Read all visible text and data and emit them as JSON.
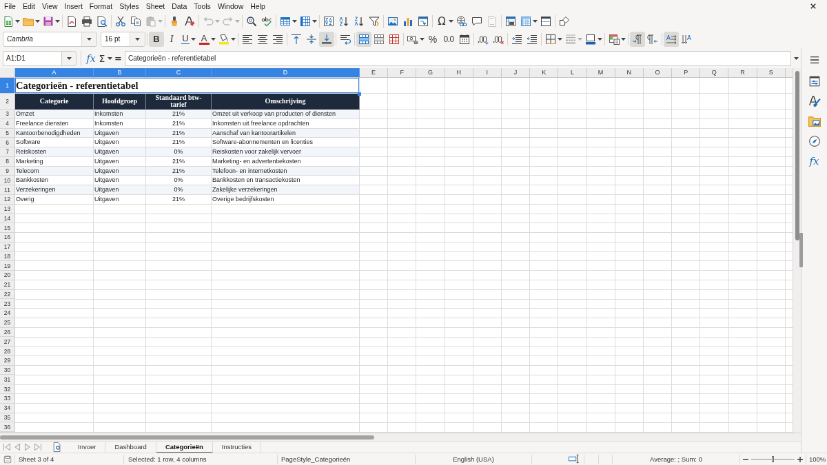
{
  "menu_bar": [
    "File",
    "Edit",
    "View",
    "Insert",
    "Format",
    "Styles",
    "Sheet",
    "Data",
    "Tools",
    "Window",
    "Help"
  ],
  "standard_toolbar": [
    {
      "kind": "new",
      "disabled": false
    },
    {
      "kind": "open",
      "disabled": false
    },
    {
      "kind": "save",
      "disabled": false
    },
    {
      "kind": "pdf",
      "disabled": false
    },
    {
      "kind": "print",
      "disabled": false
    },
    {
      "kind": "preview",
      "disabled": false
    },
    {
      "kind": "cut",
      "disabled": false
    },
    {
      "kind": "copy",
      "disabled": false
    },
    {
      "kind": "paste",
      "disabled": true
    },
    {
      "kind": "clone",
      "disabled": false
    },
    {
      "kind": "clear",
      "disabled": false
    },
    {
      "kind": "undo",
      "disabled": true
    },
    {
      "kind": "redo",
      "disabled": true
    },
    {
      "kind": "find",
      "disabled": false
    },
    {
      "kind": "spelling",
      "disabled": false
    },
    {
      "kind": "rows",
      "disabled": false
    },
    {
      "kind": "columns",
      "disabled": false
    },
    {
      "kind": "sort",
      "disabled": false
    },
    {
      "kind": "sortasc",
      "disabled": false
    },
    {
      "kind": "sortdesc",
      "disabled": false
    },
    {
      "kind": "filter",
      "disabled": false
    },
    {
      "kind": "image",
      "disabled": false
    },
    {
      "kind": "chart",
      "disabled": false
    },
    {
      "kind": "pivot",
      "disabled": false
    },
    {
      "kind": "special",
      "label": "Ω",
      "disabled": false
    },
    {
      "kind": "link",
      "disabled": false
    },
    {
      "kind": "comment",
      "disabled": false
    },
    {
      "kind": "headerfooter",
      "disabled": true
    },
    {
      "kind": "printarea",
      "disabled": false
    },
    {
      "kind": "freeze",
      "disabled": false
    },
    {
      "kind": "split",
      "disabled": false
    },
    {
      "kind": "shapes",
      "disabled": false
    }
  ],
  "formatting_toolbar": {
    "font_name": {
      "value": "Cambria",
      "substituted": true
    },
    "font_size": {
      "value": "16 pt"
    },
    "buttons": [
      {
        "kind": "bold",
        "label": "B",
        "on": true,
        "disabled": false
      },
      {
        "kind": "italic",
        "label": "I",
        "on": false,
        "disabled": false
      },
      {
        "kind": "underline",
        "label": "U",
        "on": false,
        "disabled": false
      },
      {
        "kind": "fontcolor",
        "label": "A",
        "on": false,
        "disabled": false
      },
      {
        "kind": "highlight",
        "on": false,
        "disabled": false
      },
      {
        "kind": "alignleft",
        "on": false,
        "disabled": false
      },
      {
        "kind": "aligncenter",
        "on": false,
        "disabled": false
      },
      {
        "kind": "alignright",
        "on": false,
        "disabled": false
      },
      {
        "kind": "aligntop",
        "on": false,
        "disabled": false
      },
      {
        "kind": "valigncenter",
        "on": false,
        "disabled": false
      },
      {
        "kind": "alignbottom",
        "on": true,
        "disabled": false
      },
      {
        "kind": "wrap",
        "on": false,
        "disabled": false
      },
      {
        "kind": "mergecenter",
        "on": true,
        "disabled": false
      },
      {
        "kind": "merge",
        "on": false,
        "disabled": false
      },
      {
        "kind": "unmerge",
        "on": false,
        "disabled": false
      },
      {
        "kind": "currency",
        "on": false,
        "disabled": false
      },
      {
        "kind": "percent",
        "label": "%",
        "on": false,
        "disabled": false
      },
      {
        "kind": "number",
        "label": "0.0",
        "on": false,
        "disabled": false
      },
      {
        "kind": "date",
        "on": false,
        "disabled": false
      },
      {
        "kind": "adddecimal",
        "on": false,
        "disabled": false
      },
      {
        "kind": "deldecimal",
        "on": false,
        "disabled": false
      },
      {
        "kind": "indent",
        "on": false,
        "disabled": false
      },
      {
        "kind": "outdent",
        "on": false,
        "disabled": false
      },
      {
        "kind": "borders",
        "on": false,
        "disabled": false
      },
      {
        "kind": "borderstyle",
        "on": false,
        "disabled": true
      },
      {
        "kind": "bordercolor",
        "on": false,
        "disabled": false
      },
      {
        "kind": "conditional",
        "on": false,
        "disabled": false
      },
      {
        "kind": "ltr",
        "on": true,
        "disabled": false
      },
      {
        "kind": "rtl",
        "on": false,
        "disabled": false
      },
      {
        "kind": "textltr",
        "on": true,
        "disabled": false
      },
      {
        "kind": "textttb",
        "on": false,
        "disabled": false
      }
    ]
  },
  "formula_bar": {
    "name_box": "A1:D1",
    "function_wizard": "fx",
    "sum": "Σ",
    "formula": "=",
    "content": "Categorieën - referentietabel"
  },
  "sidebar": [
    {
      "kind": "properties"
    },
    {
      "kind": "styles"
    },
    {
      "kind": "gallery"
    },
    {
      "kind": "navigator"
    },
    {
      "kind": "functions",
      "label": "fx"
    }
  ],
  "grid": {
    "columns": [
      {
        "label": "A",
        "selected": true
      },
      {
        "label": "B",
        "selected": true
      },
      {
        "label": "C",
        "selected": true
      },
      {
        "label": "D",
        "selected": true
      },
      {
        "label": "E",
        "selected": false
      },
      {
        "label": "F",
        "selected": false
      },
      {
        "label": "G",
        "selected": false
      },
      {
        "label": "H",
        "selected": false
      },
      {
        "label": "I",
        "selected": false
      },
      {
        "label": "J",
        "selected": false
      },
      {
        "label": "K",
        "selected": false
      },
      {
        "label": "L",
        "selected": false
      },
      {
        "label": "M",
        "selected": false
      },
      {
        "label": "N",
        "selected": false
      },
      {
        "label": "O",
        "selected": false
      },
      {
        "label": "P",
        "selected": false
      },
      {
        "label": "Q",
        "selected": false
      },
      {
        "label": "R",
        "selected": false
      },
      {
        "label": "S",
        "selected": false
      }
    ],
    "rows": [
      {
        "label": "1",
        "selected": true
      },
      {
        "label": "2",
        "selected": false
      },
      {
        "label": "3",
        "selected": false
      },
      {
        "label": "4",
        "selected": false
      },
      {
        "label": "5",
        "selected": false
      },
      {
        "label": "6",
        "selected": false
      },
      {
        "label": "7",
        "selected": false
      },
      {
        "label": "8",
        "selected": false
      },
      {
        "label": "9",
        "selected": false
      },
      {
        "label": "10",
        "selected": false
      },
      {
        "label": "11",
        "selected": false
      },
      {
        "label": "12",
        "selected": false
      },
      {
        "label": "13",
        "selected": false
      },
      {
        "label": "14",
        "selected": false
      },
      {
        "label": "15",
        "selected": false
      },
      {
        "label": "16",
        "selected": false
      },
      {
        "label": "17",
        "selected": false
      },
      {
        "label": "18",
        "selected": false
      },
      {
        "label": "19",
        "selected": false
      },
      {
        "label": "20",
        "selected": false
      },
      {
        "label": "21",
        "selected": false
      },
      {
        "label": "22",
        "selected": false
      },
      {
        "label": "23",
        "selected": false
      },
      {
        "label": "24",
        "selected": false
      },
      {
        "label": "25",
        "selected": false
      },
      {
        "label": "26",
        "selected": false
      },
      {
        "label": "27",
        "selected": false
      },
      {
        "label": "28",
        "selected": false
      },
      {
        "label": "29",
        "selected": false
      },
      {
        "label": "30",
        "selected": false
      },
      {
        "label": "31",
        "selected": false
      },
      {
        "label": "32",
        "selected": false
      },
      {
        "label": "33",
        "selected": false
      },
      {
        "label": "34",
        "selected": false
      },
      {
        "label": "35",
        "selected": false
      },
      {
        "label": "36",
        "selected": false
      }
    ],
    "title": "Categorieën - referentietabel",
    "table": {
      "columns": [
        "Categorie",
        "Hoofdgroep",
        "Standaard btw-tarief",
        "Omschrijving"
      ],
      "rows": [
        [
          "Omzet",
          "Inkomsten",
          "21%",
          "Omzet uit verkoop van producten of diensten"
        ],
        [
          "Freelance diensten",
          "Inkomsten",
          "21%",
          "Inkomsten uit freelance opdrachten"
        ],
        [
          "Kantoorbenodigdheden",
          "Uitgaven",
          "21%",
          "Aanschaf van kantoorartikelen"
        ],
        [
          "Software",
          "Uitgaven",
          "21%",
          "Software-abonnementen en licenties"
        ],
        [
          "Reiskosten",
          "Uitgaven",
          "0%",
          "Reiskosten voor zakelijk vervoer"
        ],
        [
          "Marketing",
          "Uitgaven",
          "21%",
          "Marketing- en advertentiekosten"
        ],
        [
          "Telecom",
          "Uitgaven",
          "21%",
          "Telefoon- en internetkosten"
        ],
        [
          "Bankkosten",
          "Uitgaven",
          "0%",
          "Bankkosten en transactiekosten"
        ],
        [
          "Verzekeringen",
          "Uitgaven",
          "0%",
          "Zakelijke verzekeringen"
        ],
        [
          "Overig",
          "Uitgaven",
          "21%",
          "Overige bedrijfskosten"
        ]
      ]
    }
  },
  "sheet_tabs": {
    "navigation_disabled": true,
    "tabs": [
      {
        "label": "Invoer",
        "selected": false
      },
      {
        "label": "Dashboard",
        "selected": false
      },
      {
        "label": "Categorieën",
        "selected": true
      },
      {
        "label": "Instructies",
        "selected": false
      }
    ]
  },
  "status_bar": {
    "sheet": "Sheet 3 of 4",
    "selection": "Selected: 1 row, 4 columns",
    "page_style": "PageStyle_Categorieën",
    "language": "English (USA)",
    "summary": "Average: ; Sum: 0",
    "zoom": {
      "level": 0.5,
      "percent": "100%"
    }
  }
}
